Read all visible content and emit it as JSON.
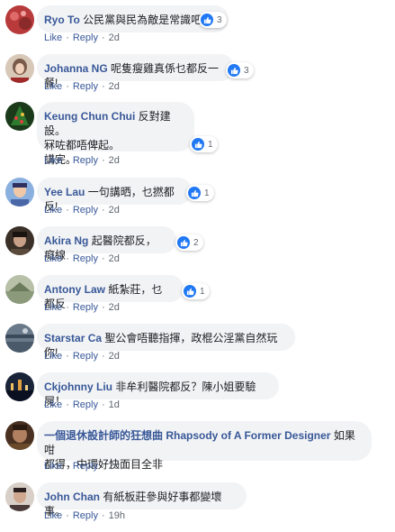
{
  "comments": [
    {
      "author": "Ryo To",
      "text": "公民黨與民為敵是常識吧",
      "text2": "",
      "text3": "",
      "reactions": "3",
      "actions": {
        "like": "Like",
        "reply": "Reply"
      },
      "time": "2d",
      "avatar_color": "#b83a3a"
    },
    {
      "author": "Johanna NG",
      "text": "呢隻瘦雞真係乜都反一餐!",
      "text2": "",
      "text3": "",
      "reactions": "3",
      "actions": {
        "like": "Like",
        "reply": "Reply"
      },
      "time": "2d",
      "avatar_color": "#7a5a4a"
    },
    {
      "author": "Keung Chun Chui",
      "text": "反對建設。",
      "text2": "冧咗都唔俾起。",
      "text3": "講完。",
      "reactions": "1",
      "actions": {
        "like": "Like",
        "reply": "Reply"
      },
      "time": "2d",
      "avatar_color": "#2e5a2e"
    },
    {
      "author": "Yee Lau",
      "text": "一句講晒，乜撚都反!",
      "text2": "",
      "text3": "",
      "reactions": "1",
      "actions": {
        "like": "Like",
        "reply": "Reply"
      },
      "time": "2d",
      "avatar_color": "#4a68a8"
    },
    {
      "author": "Akira Ng",
      "text": "起醫院都反，癡線",
      "text2": "",
      "text3": "",
      "reactions": "2",
      "actions": {
        "like": "Like",
        "reply": "Reply"
      },
      "time": "2d",
      "avatar_color": "#5a4a3a"
    },
    {
      "author": "Antony Law",
      "text": "紙紮莊，乜都反",
      "text2": "",
      "text3": "",
      "reactions": "1",
      "actions": {
        "like": "Like",
        "reply": "Reply"
      },
      "time": "2d",
      "avatar_color": "#8a9a7a"
    },
    {
      "author": "Starstar Ca",
      "text": "聖公會唔聽指揮，政棍公淫黨自然玩你!",
      "text2": "",
      "text3": "",
      "reactions": "",
      "actions": {
        "like": "Like",
        "reply": "Reply"
      },
      "time": "2d",
      "avatar_color": "#6a7a8a"
    },
    {
      "author": "Ckjohnny Liu",
      "text": "非牟利醫院都反？陳小姐要驗屍！",
      "text2": "",
      "text3": "",
      "reactions": "",
      "actions": {
        "like": "Like",
        "reply": "Reply"
      },
      "time": "1d",
      "avatar_color": "#3a4a6a"
    },
    {
      "author": "一個退休設計師的狂想曲 Rhapsody of A Former Designer",
      "text": "如果咁",
      "text2": "都得，中環好快面目全非",
      "text3": "",
      "reactions": "",
      "actions": {
        "like": "Like",
        "reply": "Reply"
      },
      "time": "2d",
      "avatar_color": "#6a4a2a"
    },
    {
      "author": "John Chan",
      "text": "有紙板莊參與好事都變壞事。",
      "text2": "",
      "text3": "",
      "reactions": "",
      "actions": {
        "like": "Like",
        "reply": "Reply"
      },
      "time": "19h",
      "avatar_color": "#4a3a3a"
    }
  ],
  "colors": {
    "author": "#385898",
    "bubble": "#f2f3f5",
    "like_blue": "#2078f4",
    "meta": "#606770"
  },
  "icons": {
    "reaction": "like-thumb-icon"
  }
}
